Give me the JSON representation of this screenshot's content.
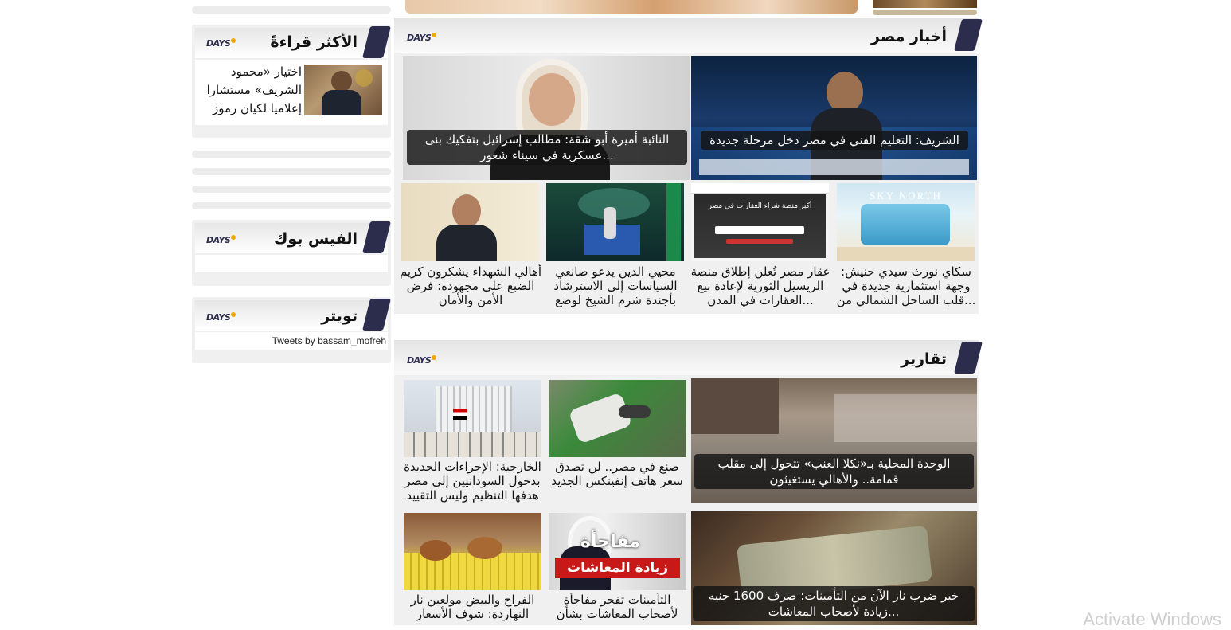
{
  "sidebar": {
    "most_read": {
      "title": "الأكثر قراءةً",
      "logo": "DAYS",
      "item_text": "اختيار «محمود الشريف» مستشارا إعلاميا لكيان رموز"
    },
    "facebook": {
      "title": "الفيس بوك",
      "logo": "DAYS"
    },
    "twitter": {
      "title": "تويتر",
      "logo": "DAYS",
      "embed_text": "Tweets by bassam_mofreh"
    }
  },
  "egypt_news": {
    "title": "أخبار مصر",
    "logo": "DAYS",
    "featured": [
      {
        "caption": "الشريف: التعليم الفني في مصر دخل مرحلة جديدة"
      },
      {
        "caption": "النائبة أميرة أبو شقة: مطالب إسرائيل بتفكيك بنى عسكرية في سيناء شعور..."
      }
    ],
    "items": [
      {
        "text": "سكاي نورث سيدي حنيش: وجهة استثمارية جديدة في قلب الساحل الشمالي من...",
        "image_label": "SKY NORTH"
      },
      {
        "text": "عقار مصر تُعلن إطلاق منصة الريسيل الثورية لإعادة بيع العقارات في المدن...",
        "image_label": "أكبر منصة شراء العقارات في مصر"
      },
      {
        "text": "محيي الدين يدعو صانعي السياسات إلى الاسترشاد بأجندة شرم الشيخ لوضع"
      },
      {
        "text": "أهالي الشهداء يشكرون كريم الضبع على مجهوده: فرض الأمن والأمان"
      }
    ]
  },
  "reports": {
    "title": "تقارير",
    "logo": "DAYS",
    "featured": [
      {
        "caption": "الوحدة المحلية بـ«نكلا العنب» تتحول إلى مقلب قمامة.. والأهالي يستغيثون"
      },
      {
        "caption": "خبر ضرب نار الآن من التأمينات: صرف 1600 جنيه زيادة لأصحاب المعاشات..."
      }
    ],
    "items": [
      {
        "text": "صنع في مصر.. لن تصدق سعر هاتف إنفينكس الجديد"
      },
      {
        "text": "الخارجية: الإجراءات الجديدة بدخول السودانيين إلى مصر هدفها التنظيم وليس التقييد"
      },
      {
        "text": "التأمينات تفجر مفاجأة لأصحاب المعاشات بشأن",
        "image_label_1": "مفاجأة",
        "image_label_2": "زيادة المعاشات"
      },
      {
        "text": "الفراخ والبيض مولعين نار النهاردة: شوف الأسعار"
      }
    ]
  },
  "os_watermark": "Activate Windows"
}
